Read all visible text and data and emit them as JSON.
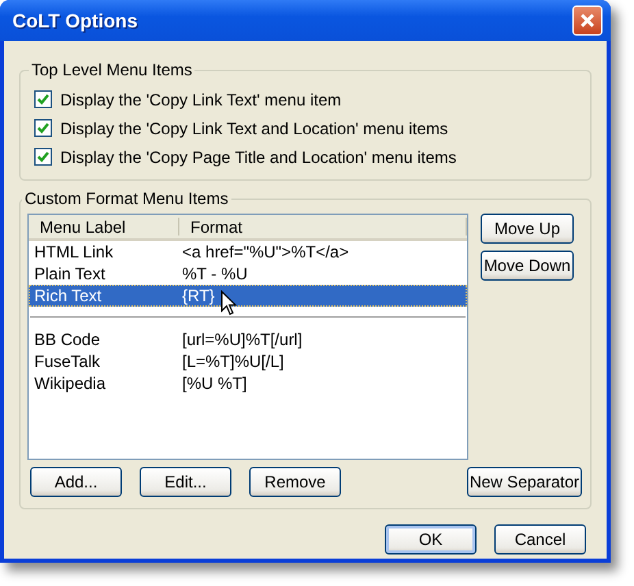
{
  "window": {
    "title": "CoLT Options"
  },
  "top_level_group": {
    "title": "Top Level Menu Items",
    "options": [
      {
        "label": "Display the 'Copy Link Text' menu item",
        "checked": true
      },
      {
        "label": "Display the 'Copy Link Text and Location' menu items",
        "checked": true
      },
      {
        "label": "Display the 'Copy Page Title and Location' menu items",
        "checked": true
      }
    ]
  },
  "custom_group": {
    "title": "Custom Format Menu Items",
    "table": {
      "columns": [
        "Menu Label",
        "Format"
      ],
      "rows": [
        {
          "kind": "entry",
          "label": "HTML Link",
          "format": "<a href=\"%U\">%T</a>",
          "selected": false
        },
        {
          "kind": "entry",
          "label": "Plain Text",
          "format": "%T - %U",
          "selected": false
        },
        {
          "kind": "entry",
          "label": "Rich Text",
          "format": "{RT}",
          "selected": true
        },
        {
          "kind": "separator",
          "selected": false
        },
        {
          "kind": "entry",
          "label": "BB Code",
          "format": "[url=%U]%T[/url]",
          "selected": false
        },
        {
          "kind": "entry",
          "label": "FuseTalk",
          "format": "[L=%T]%U[/L]",
          "selected": false
        },
        {
          "kind": "entry",
          "label": "Wikipedia",
          "format": "[%U %T]",
          "selected": false
        }
      ]
    },
    "side_buttons": [
      "Move Up",
      "Move Down"
    ],
    "bottom_buttons": [
      "Add...",
      "Edit...",
      "Remove"
    ],
    "separator_button": "New Separator"
  },
  "dialog_buttons": [
    {
      "label": "OK",
      "default": true
    },
    {
      "label": "Cancel",
      "default": false
    }
  ]
}
